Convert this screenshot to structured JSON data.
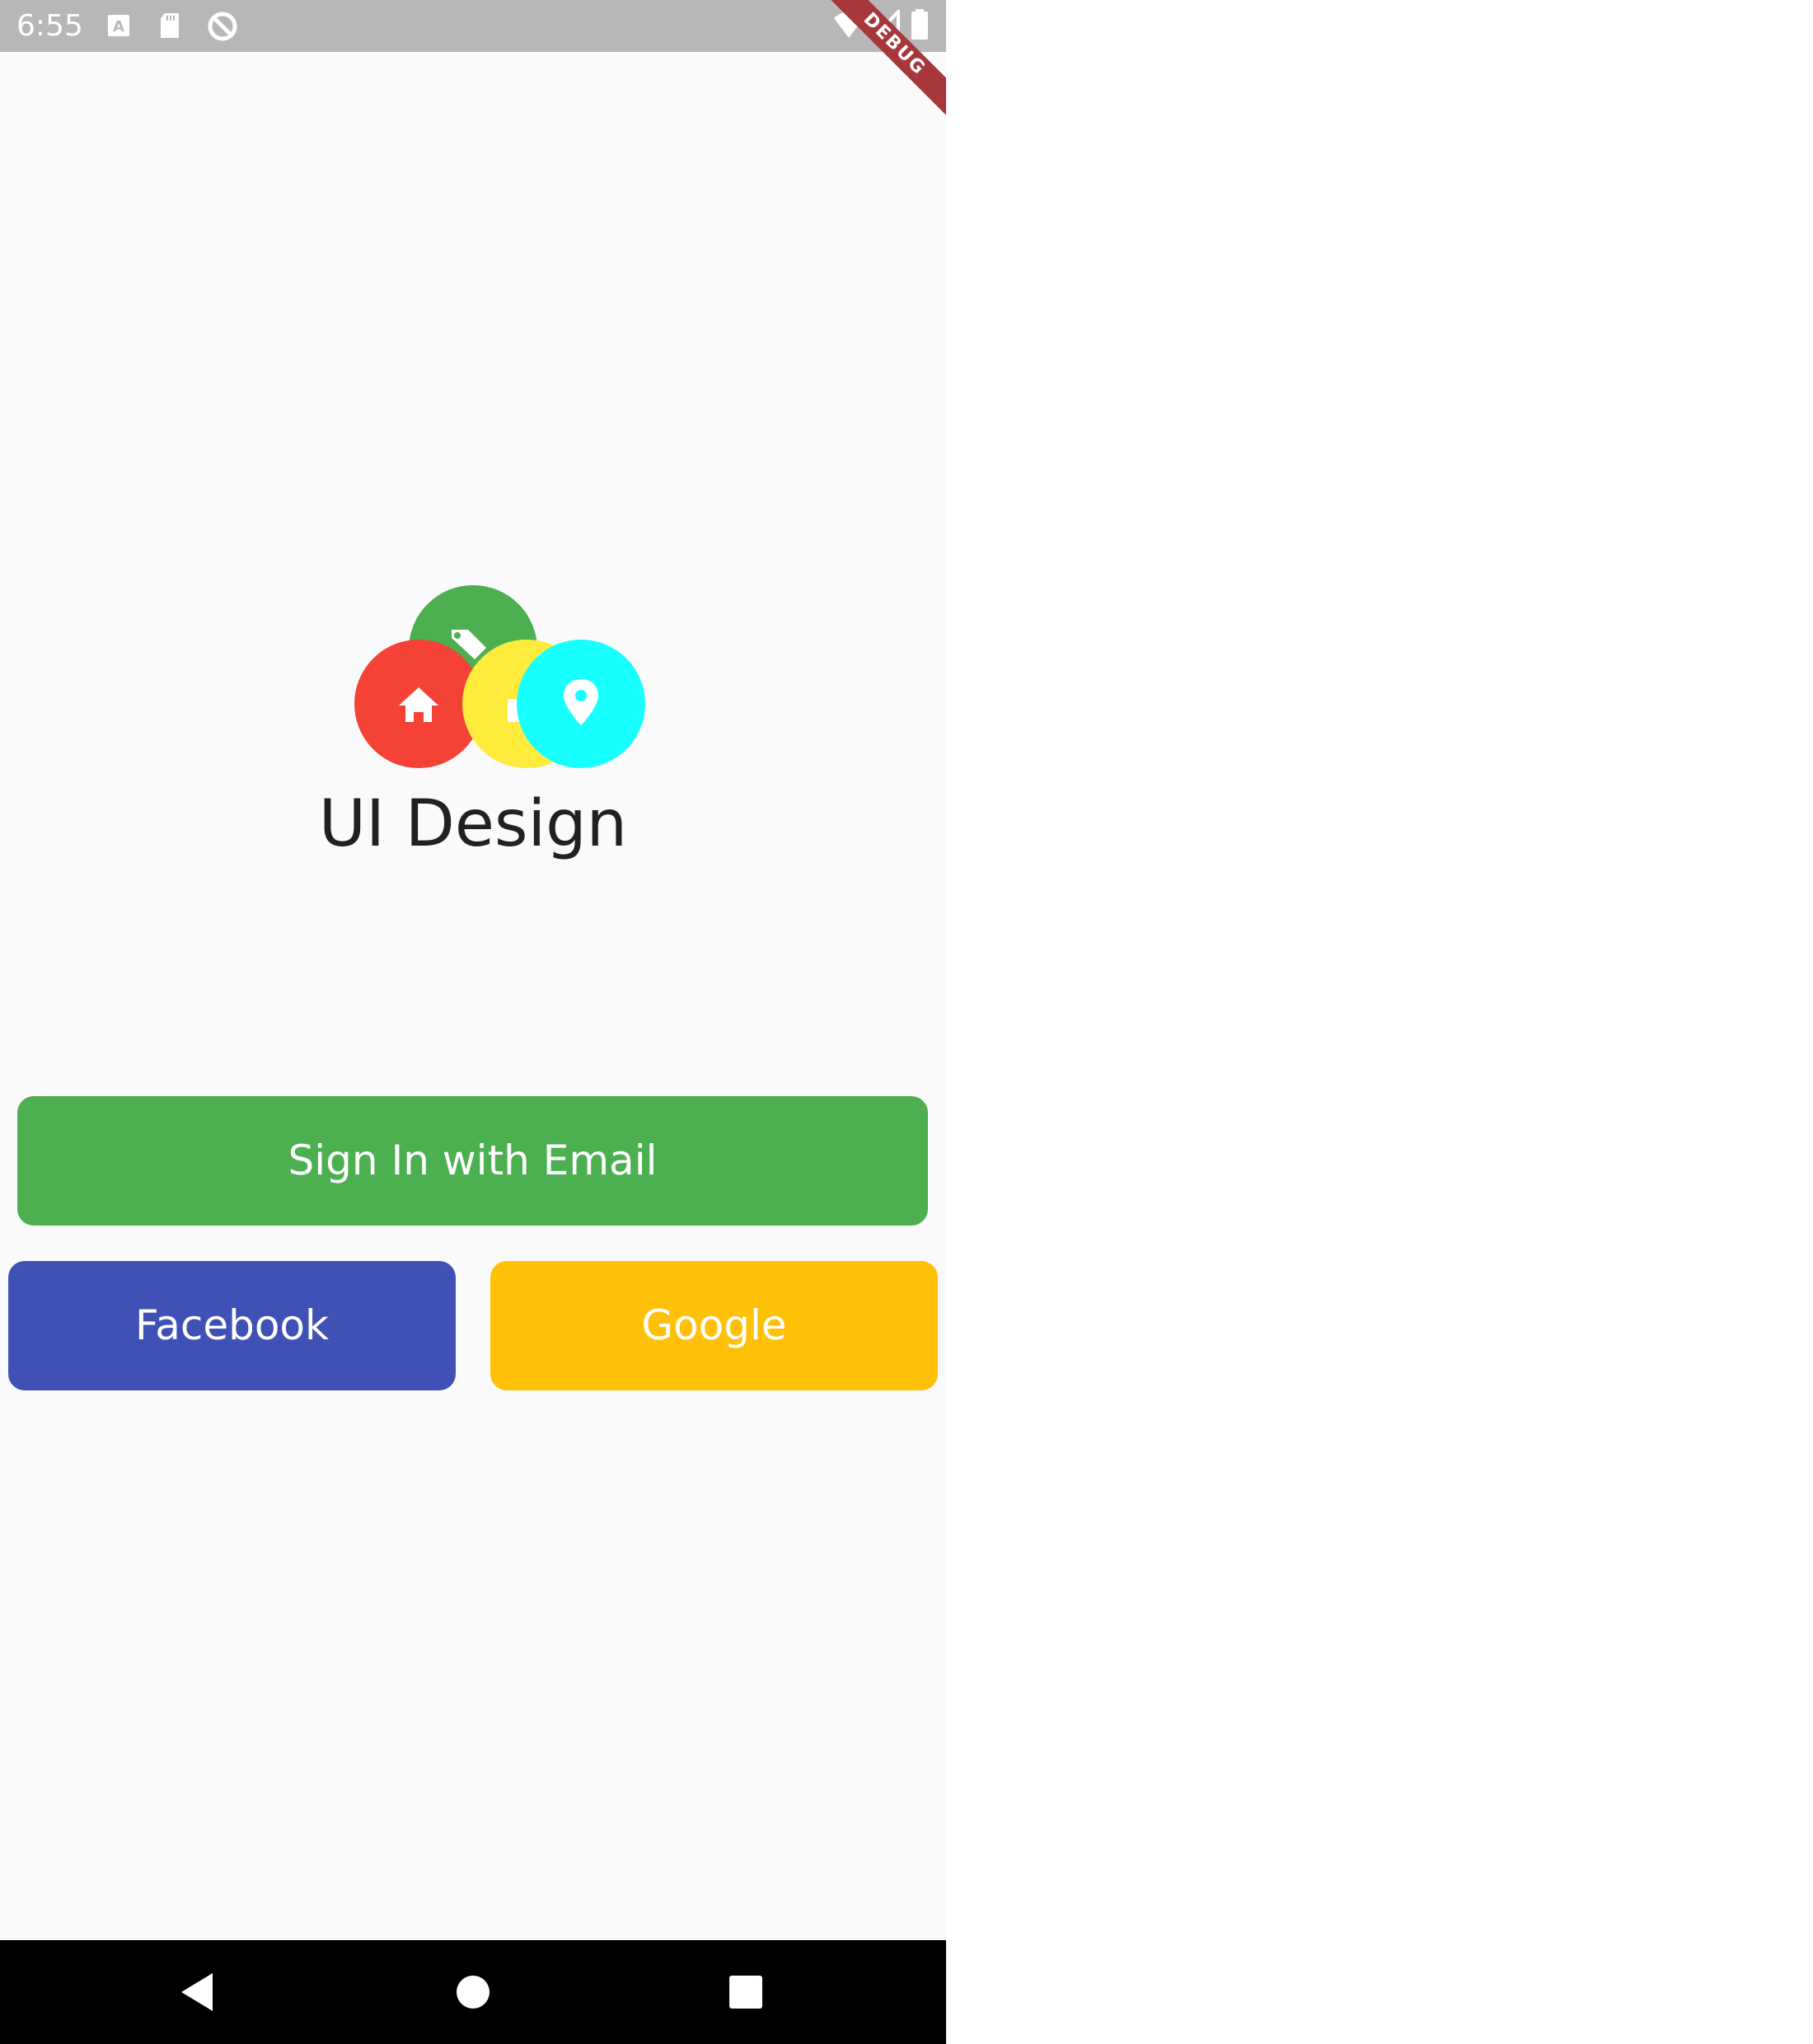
{
  "status_bar": {
    "time": "6:55",
    "left_icons": [
      "text-notification-icon",
      "sd-card-icon",
      "sync-icon"
    ],
    "right_icons": [
      "wifi-icon",
      "signal-icon",
      "battery-icon"
    ],
    "debug_banner": "DEBUG"
  },
  "logo": {
    "circles": [
      {
        "color": "#4caf50",
        "icon": "tag-icon"
      },
      {
        "color": "#f44336",
        "icon": "home-icon"
      },
      {
        "color": "#ffeb3b",
        "icon": "car-icon"
      },
      {
        "color": "#18ffff",
        "icon": "location-pin-icon"
      }
    ]
  },
  "app_title": "UI Design",
  "buttons": {
    "email": {
      "label": "Sign In with Email",
      "color": "#4caf50"
    },
    "facebook": {
      "label": "Facebook",
      "color": "#3f51b5"
    },
    "google": {
      "label": "Google",
      "color": "#ffc107"
    }
  },
  "nav_bar": {
    "items": [
      "back-icon",
      "home-icon",
      "recents-icon"
    ]
  }
}
